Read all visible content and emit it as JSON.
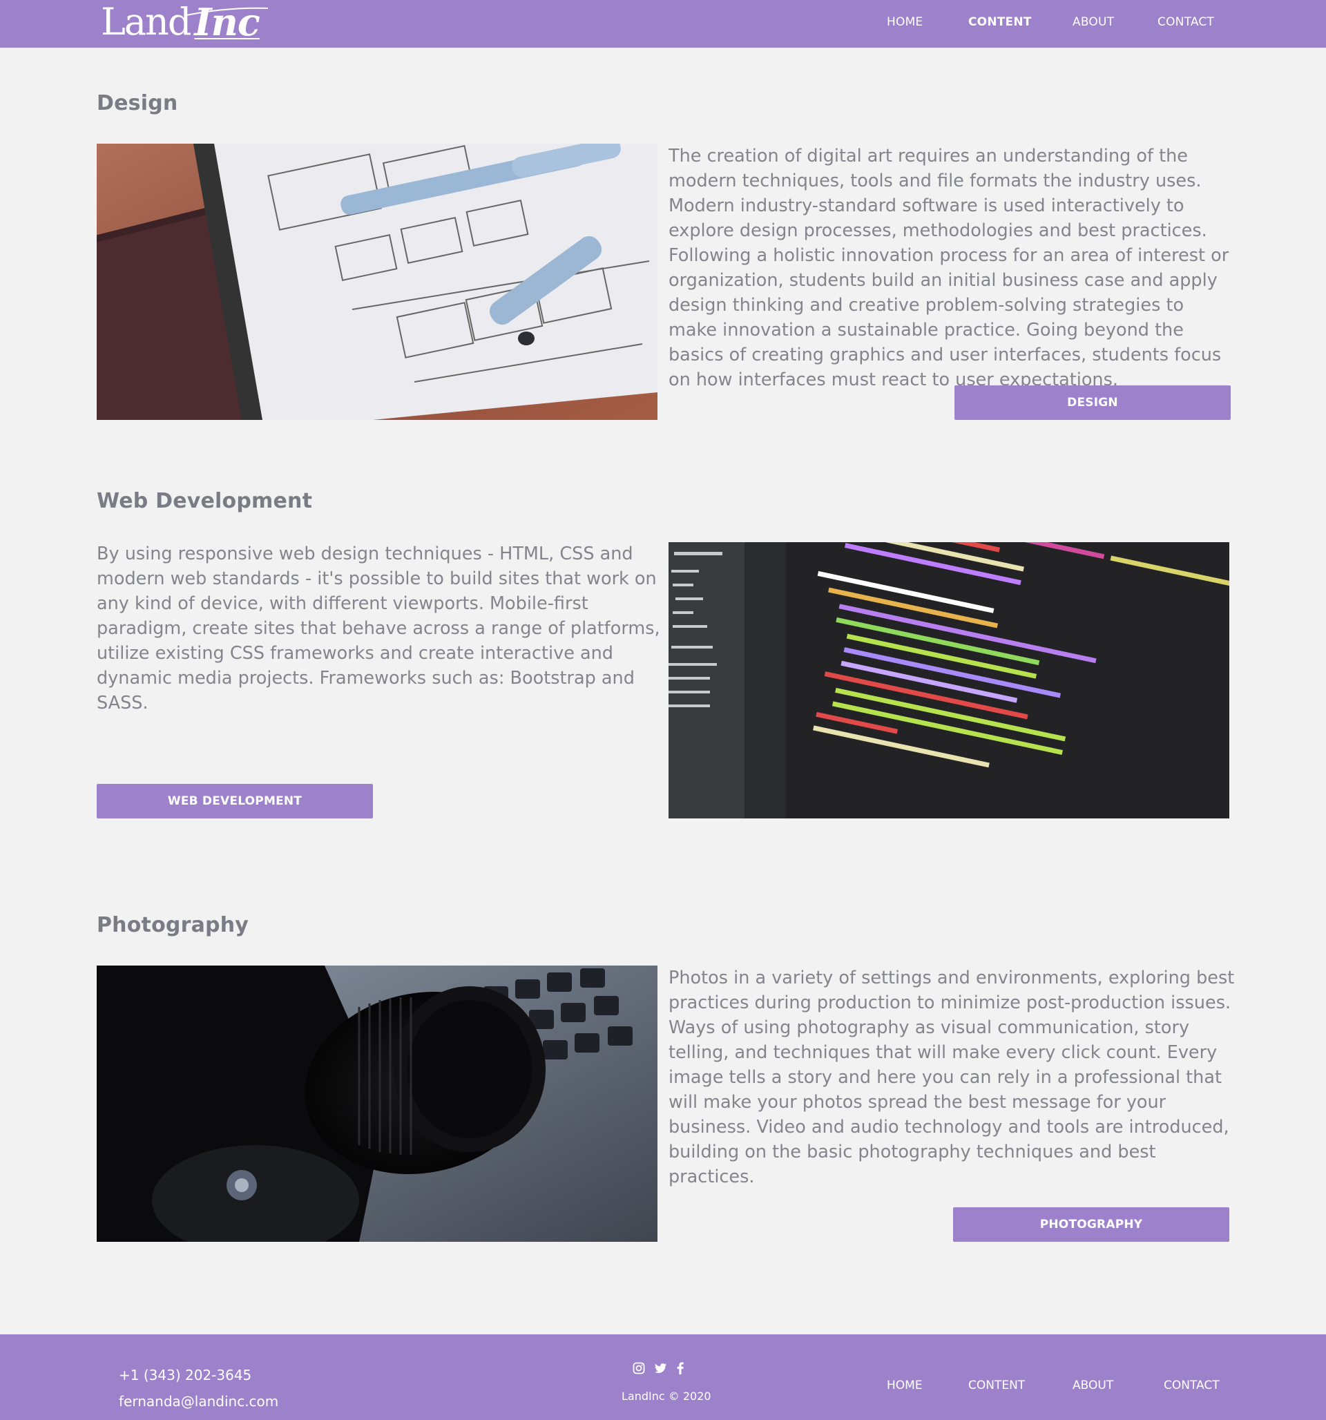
{
  "header": {
    "logo_text_1": "Land",
    "logo_text_2": "Inc",
    "nav": [
      {
        "label": "HOME",
        "active": false
      },
      {
        "label": "CONTENT",
        "active": true
      },
      {
        "label": "ABOUT",
        "active": false
      },
      {
        "label": "CONTACT",
        "active": false
      }
    ]
  },
  "sections": {
    "design": {
      "title": "Design",
      "text": "The creation of digital art requires an understanding of the modern techniques, tools and file formats the industry uses. Modern industry-standard software is used interactively to explore design processes, methodologies and best practices. Following a holistic innovation process for an area of interest or organization, students build an initial business case and apply design thinking and creative problem-solving strategies to make innovation a sustainable practice. Going beyond the basics of creating graphics and user interfaces, students focus on how interfaces must react to user expectations.",
      "button": "DESIGN"
    },
    "webdev": {
      "title": "Web Development",
      "text": "By using responsive web design techniques - HTML, CSS and modern web standards - it's possible to build sites that work on any kind of device, with different viewports. Mobile-first paradigm, create sites that behave across a range of platforms, utilize existing CSS frameworks and create interactive and dynamic media projects. Frameworks such as: Bootstrap and SASS.",
      "button": "WEB DEVELOPMENT"
    },
    "photography": {
      "title": "Photography",
      "text": "Photos in a variety of settings and environments, exploring best practices during production to minimize post-production issues. Ways of using photography as visual communication, story telling, and techniques that will make every click count. Every image tells a story and here you can rely in a professional that will make your photos spread the best message for your business. Video and audio technology and tools are introduced, building on the basic photography techniques and best practices.",
      "button": "PHOTOGRAPHY"
    }
  },
  "footer": {
    "phone": "+1 (343) 202-3645",
    "email": "fernanda@landinc.com",
    "social": [
      "instagram-icon",
      "twitter-icon",
      "facebook-icon"
    ],
    "copyright": "LandInc © 2020",
    "nav": [
      "HOME",
      "CONTENT",
      "ABOUT",
      "CONTACT"
    ]
  },
  "colors": {
    "brand": "#9d82cb",
    "background": "#f2f2f2",
    "text": "#7b7b85"
  }
}
